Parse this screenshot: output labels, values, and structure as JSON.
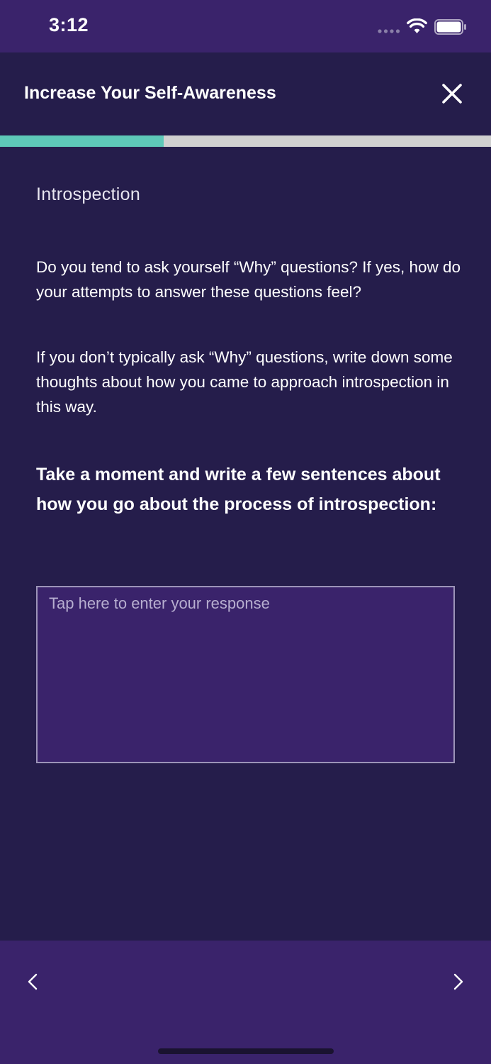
{
  "status_bar": {
    "time": "3:12",
    "icons": [
      "signal-dots-icon",
      "wifi-icon",
      "battery-icon"
    ]
  },
  "header": {
    "title": "Increase Your Self-Awareness",
    "close_icon": "close-icon"
  },
  "progress": {
    "fraction": 0.333,
    "fill_color": "#5ec8b8",
    "track_color": "#d0d0d0"
  },
  "content": {
    "section_label": "Introspection",
    "paragraphs": [
      "Do you tend to ask yourself “Why” questions? If yes, how do your attempts to answer these questions feel?",
      "If you don’t typically ask “Why” questions, write down some thoughts about how you came to approach introspection in this way."
    ],
    "prompt": "Take a moment and write a few sentences about how you go about the process of introspection:",
    "response": {
      "value": "",
      "placeholder": "Tap here to enter your response"
    }
  },
  "footer": {
    "prev_icon": "chevron-left-icon",
    "next_icon": "chevron-right-icon"
  },
  "colors": {
    "background": "#251d4b",
    "bar_purple": "#3a236b",
    "accent_teal": "#5ec8b8",
    "text": "#ffffff"
  }
}
